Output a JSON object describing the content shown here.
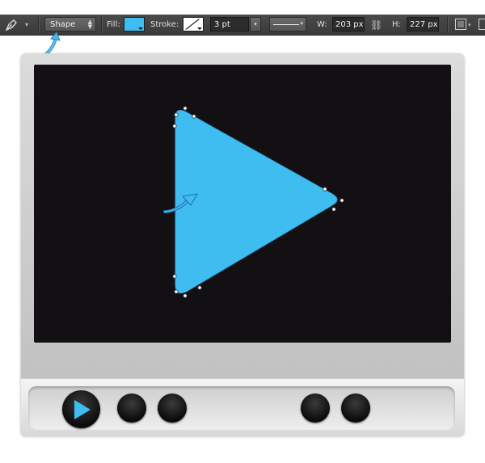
{
  "toolbar": {
    "tool_icon": "pen-icon",
    "mode": "Shape",
    "fill_label": "Fill:",
    "fill_color": "#3fbdf0",
    "stroke_label": "Stroke:",
    "stroke_width": "3 pt",
    "width_label": "W:",
    "width_value": "203 px",
    "link_icon": "link-icon",
    "height_label": "H:",
    "height_value": "227 px"
  },
  "canvas": {
    "player_frame_color": "#c8c8c8",
    "screen_color": "#121013",
    "triangle_color": "#3fbdf0",
    "hint_arrow_color": "#3aa8e0",
    "controls": [
      "play-button",
      "control-button-1",
      "control-button-2",
      "control-button-3",
      "control-button-4"
    ]
  }
}
